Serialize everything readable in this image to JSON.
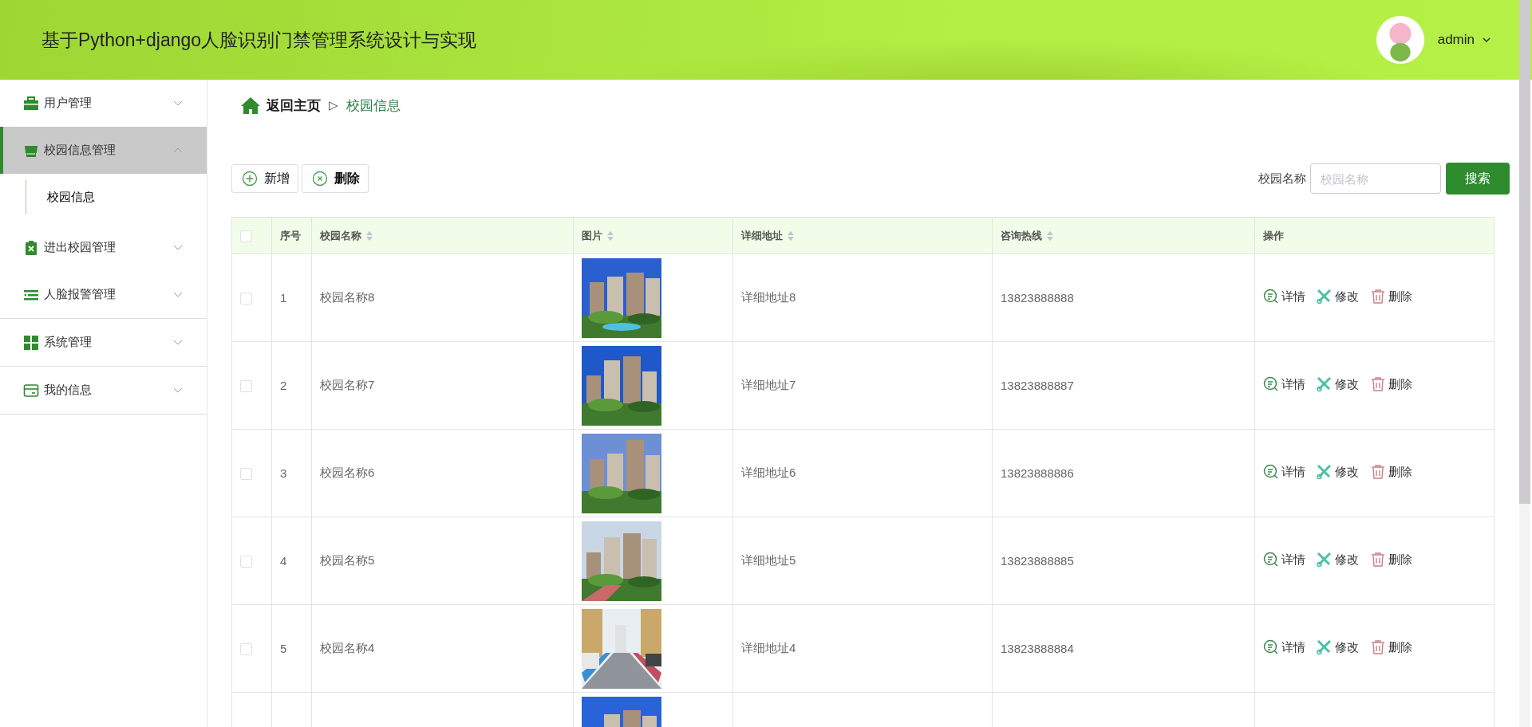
{
  "header": {
    "title": "基于Python+django人脸识别门禁管理系统设计与实现",
    "user": "admin"
  },
  "sidebar": {
    "items": [
      {
        "label": "用户管理",
        "expanded": false,
        "selected": false
      },
      {
        "label": "校园信息管理",
        "expanded": true,
        "selected": true,
        "children": [
          {
            "label": "校园信息",
            "selected": true
          }
        ]
      },
      {
        "label": "进出校园管理",
        "expanded": false,
        "selected": false
      },
      {
        "label": "人脸报警管理",
        "expanded": false,
        "selected": false
      },
      {
        "label": "系统管理",
        "expanded": false,
        "selected": false
      },
      {
        "label": "我的信息",
        "expanded": false,
        "selected": false
      }
    ]
  },
  "breadcrumb": {
    "home": "返回主页",
    "separator": "▷",
    "current": "校园信息"
  },
  "toolbar": {
    "buttons": [
      {
        "label": "新增",
        "kind": "add"
      },
      {
        "label": "删除",
        "kind": "delete"
      }
    ],
    "search": {
      "label": "校园名称",
      "placeholder": "校园名称",
      "button": "搜索"
    }
  },
  "table": {
    "columns": [
      {
        "kind": "checkbox",
        "checked": false
      },
      {
        "label": "序号",
        "sortable": false
      },
      {
        "label": "校园名称",
        "sortable": true
      },
      {
        "label": "图片",
        "sortable": true
      },
      {
        "label": "详细地址",
        "sortable": true
      },
      {
        "label": "咨询热线",
        "sortable": true
      },
      {
        "label": "操作",
        "sortable": false
      }
    ],
    "rows": [
      {
        "checked": false,
        "index": "1",
        "name": "校园名称8",
        "image": {
          "kind": "picture"
        },
        "address": "详细地址8",
        "phone": "13823888888",
        "actions": [
          {
            "kind": "detail",
            "label": "详情"
          },
          {
            "kind": "edit",
            "label": "修改"
          },
          {
            "kind": "delete",
            "label": "删除"
          }
        ]
      },
      {
        "checked": false,
        "index": "2",
        "name": "校园名称7",
        "image": {
          "kind": "picture"
        },
        "address": "详细地址7",
        "phone": "13823888887",
        "actions": [
          {
            "kind": "detail",
            "label": "详情"
          },
          {
            "kind": "edit",
            "label": "修改"
          },
          {
            "kind": "delete",
            "label": "删除"
          }
        ]
      },
      {
        "checked": false,
        "index": "3",
        "name": "校园名称6",
        "image": {
          "kind": "picture"
        },
        "address": "详细地址6",
        "phone": "13823888886",
        "actions": [
          {
            "kind": "detail",
            "label": "详情"
          },
          {
            "kind": "edit",
            "label": "修改"
          },
          {
            "kind": "delete",
            "label": "删除"
          }
        ]
      },
      {
        "checked": false,
        "index": "4",
        "name": "校园名称5",
        "image": {
          "kind": "picture"
        },
        "address": "详细地址5",
        "phone": "13823888885",
        "actions": [
          {
            "kind": "detail",
            "label": "详情"
          },
          {
            "kind": "edit",
            "label": "修改"
          },
          {
            "kind": "delete",
            "label": "删除"
          }
        ]
      },
      {
        "checked": false,
        "index": "5",
        "name": "校园名称4",
        "image": {
          "kind": "picture"
        },
        "address": "详细地址4",
        "phone": "13823888884",
        "actions": [
          {
            "kind": "detail",
            "label": "详情"
          },
          {
            "kind": "edit",
            "label": "修改"
          },
          {
            "kind": "delete",
            "label": "删除"
          }
        ]
      },
      {
        "image": {
          "kind": "picture"
        }
      }
    ]
  }
}
